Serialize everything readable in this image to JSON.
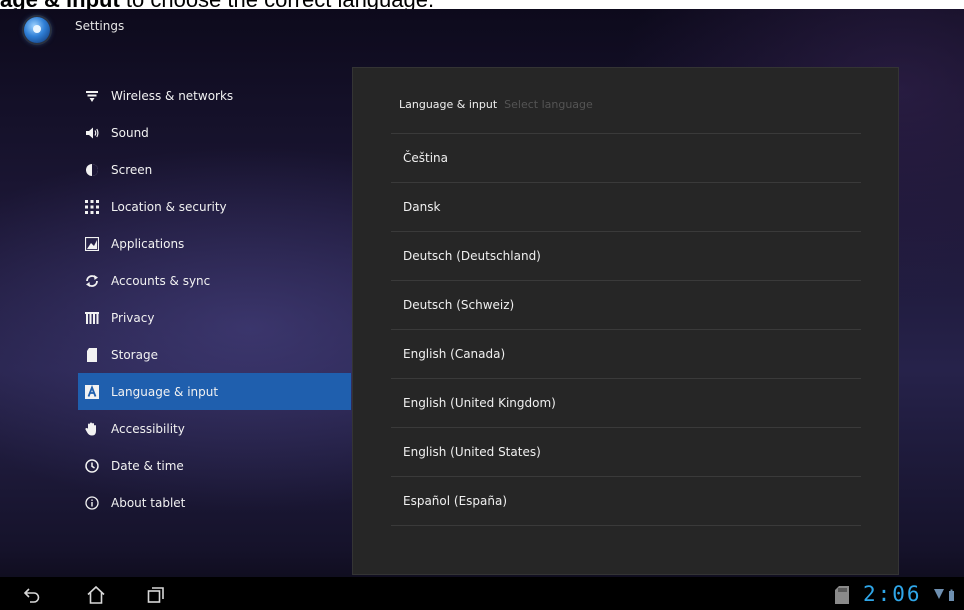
{
  "caption": {
    "bold": "age & input",
    "rest": " to choose the correct language."
  },
  "app": {
    "title": "Settings"
  },
  "sidebar": {
    "items": [
      {
        "label": "Wireless & networks",
        "icon": "wifi-icon"
      },
      {
        "label": "Sound",
        "icon": "speaker-icon"
      },
      {
        "label": "Screen",
        "icon": "brightness-icon"
      },
      {
        "label": "Location & security",
        "icon": "grid-icon"
      },
      {
        "label": "Applications",
        "icon": "applications-icon"
      },
      {
        "label": "Accounts & sync",
        "icon": "sync-icon"
      },
      {
        "label": "Privacy",
        "icon": "privacy-icon"
      },
      {
        "label": "Storage",
        "icon": "sd-card-icon"
      },
      {
        "label": "Language & input",
        "icon": "keyboard-a-icon",
        "selected": true
      },
      {
        "label": "Accessibility",
        "icon": "hand-icon"
      },
      {
        "label": "Date & time",
        "icon": "clock-icon"
      },
      {
        "label": "About tablet",
        "icon": "info-icon"
      }
    ]
  },
  "panel": {
    "breadcrumb": {
      "main": "Language & input",
      "sub": "Select language"
    },
    "languages": [
      "Čeština",
      "Dansk",
      "Deutsch (Deutschland)",
      "Deutsch (Schweiz)",
      "English (Canada)",
      "English (United Kingdom)",
      "English (United States)",
      "Español (España)"
    ]
  },
  "system_bar": {
    "buttons": [
      "back-icon",
      "home-icon",
      "recent-apps-icon"
    ],
    "time": "2:06"
  },
  "colors": {
    "selected": "#1f5fae",
    "clock": "#2fa6e8",
    "panel": "#262626"
  }
}
